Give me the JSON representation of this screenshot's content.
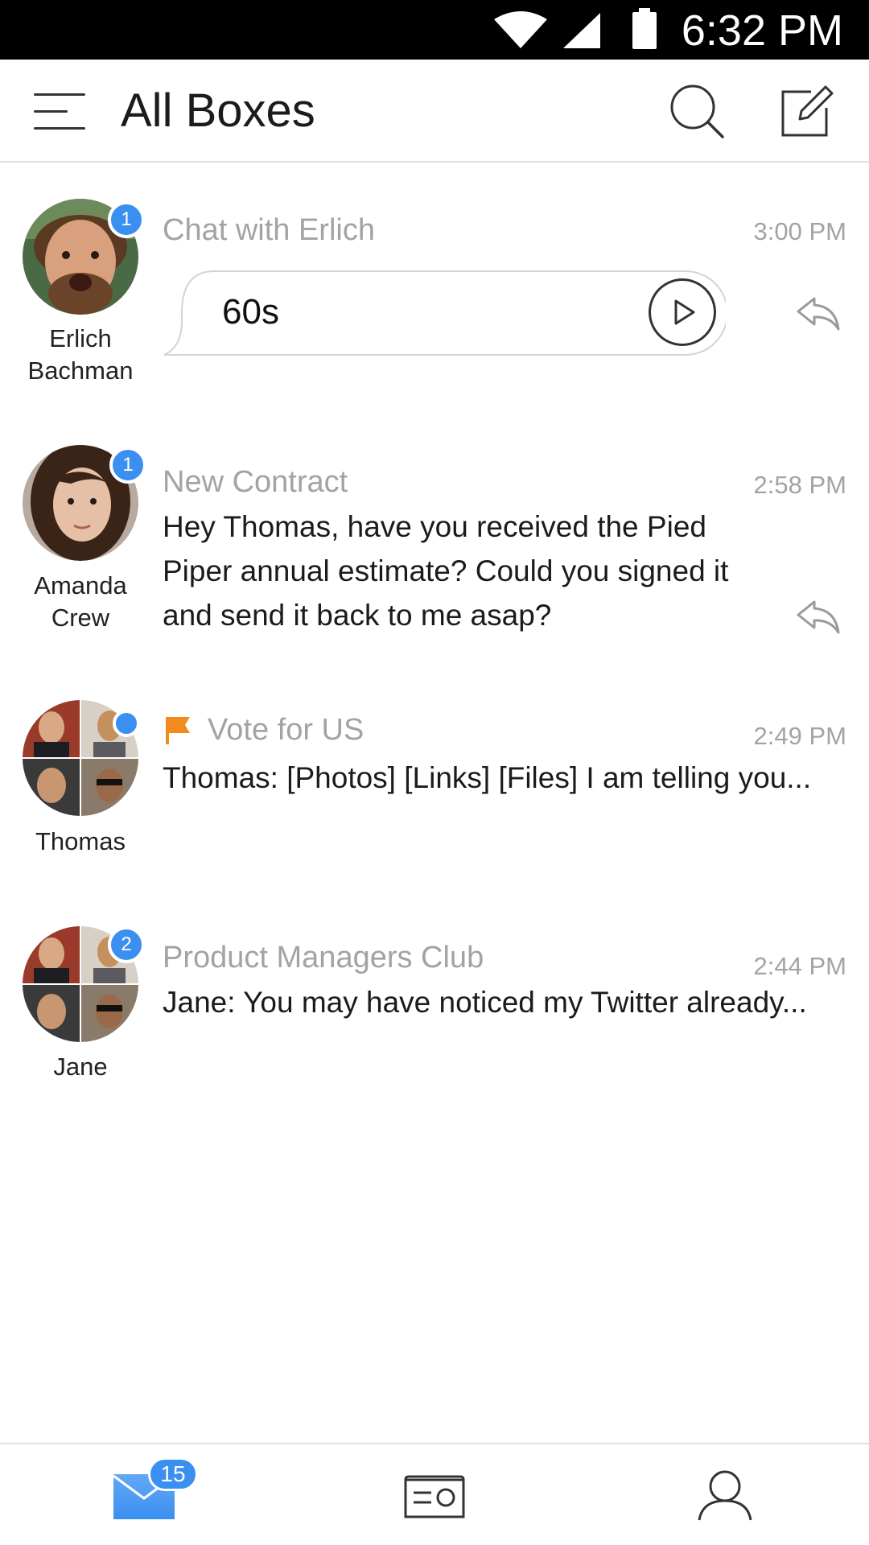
{
  "status_bar": {
    "time": "6:32 PM",
    "icons": [
      "wifi-icon",
      "cell-signal-icon",
      "battery-icon"
    ]
  },
  "app_bar": {
    "title": "All Boxes",
    "icons": [
      "menu-icon",
      "search-icon",
      "compose-icon"
    ]
  },
  "conversations": [
    {
      "contact_name": "Erlich Bachman",
      "unread_count": "1",
      "subject": "Chat with Erlich",
      "time": "3:00 PM",
      "voice_message": {
        "duration": "60s"
      }
    },
    {
      "contact_name": "Amanda Crew",
      "unread_count": "1",
      "subject": "New Contract",
      "time": "2:58 PM",
      "preview": "Hey Thomas, have you received the Pied Piper annual estimate? Could you signed it and send it back to me asap?"
    },
    {
      "contact_name": "Thomas",
      "unread_dot": true,
      "flagged": true,
      "subject": "Vote for US",
      "time": "2:49 PM",
      "preview": "Thomas: [Photos] [Links] [Files] I am telling you..."
    },
    {
      "contact_name": "Jane",
      "unread_count": "2",
      "subject": "Product Managers Club",
      "time": "2:44 PM",
      "preview": "Jane: You may have noticed my Twitter already..."
    }
  ],
  "bottom_nav": {
    "inbox_badge": "15",
    "icons": [
      "mail-icon",
      "card-icon",
      "profile-icon"
    ]
  },
  "colors": {
    "accent_blue": "#3b8ff0",
    "flag_orange": "#f28a1e",
    "muted_text": "#a3a3a3",
    "status_bar": "#000000"
  }
}
